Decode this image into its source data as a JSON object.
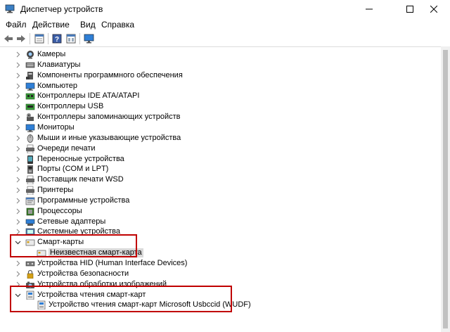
{
  "window": {
    "title": "Диспетчер устройств"
  },
  "menu": {
    "items": [
      {
        "label": "Файл"
      },
      {
        "label": "Действие"
      },
      {
        "label": "Вид"
      },
      {
        "label": "Справка"
      }
    ]
  },
  "toolbar": {
    "buttons": [
      {
        "icon": "back-arrow-icon"
      },
      {
        "icon": "forward-arrow-icon"
      },
      {
        "icon": "properties-icon"
      },
      {
        "icon": "help-icon"
      },
      {
        "icon": "details-icon"
      },
      {
        "icon": "monitor-icon"
      }
    ]
  },
  "tree": {
    "nodes": [
      {
        "label": "Камеры",
        "icon": "camera-icon",
        "expanded": false
      },
      {
        "label": "Клавиатуры",
        "icon": "keyboard-icon",
        "expanded": false
      },
      {
        "label": "Компоненты программного обеспечения",
        "icon": "software-component-icon",
        "expanded": false
      },
      {
        "label": "Компьютер",
        "icon": "computer-icon",
        "expanded": false
      },
      {
        "label": "Контроллеры IDE ATA/ATAPI",
        "icon": "ide-controller-icon",
        "expanded": false
      },
      {
        "label": "Контроллеры USB",
        "icon": "usb-icon",
        "expanded": false
      },
      {
        "label": "Контроллеры запоминающих устройств",
        "icon": "storage-controller-icon",
        "expanded": false
      },
      {
        "label": "Мониторы",
        "icon": "monitor-icon",
        "expanded": false
      },
      {
        "label": "Мыши и иные указывающие устройства",
        "icon": "mouse-icon",
        "expanded": false
      },
      {
        "label": "Очереди печати",
        "icon": "print-queue-icon",
        "expanded": false
      },
      {
        "label": "Переносные устройства",
        "icon": "portable-device-icon",
        "expanded": false
      },
      {
        "label": "Порты (COM и LPT)",
        "icon": "port-icon",
        "expanded": false
      },
      {
        "label": "Поставщик печати WSD",
        "icon": "printer-icon",
        "expanded": false
      },
      {
        "label": "Принтеры",
        "icon": "printer-icon",
        "expanded": false
      },
      {
        "label": "Программные устройства",
        "icon": "software-device-icon",
        "expanded": false
      },
      {
        "label": "Процессоры",
        "icon": "processor-icon",
        "expanded": false
      },
      {
        "label": "Сетевые адаптеры",
        "icon": "network-adapter-icon",
        "expanded": false
      },
      {
        "label": "Системные устройства",
        "icon": "system-device-icon",
        "expanded": false
      },
      {
        "label": "Смарт-карты",
        "icon": "smart-card-icon",
        "expanded": true
      },
      {
        "label": "Неизвестная смарт-карта",
        "icon": "smart-card-icon",
        "child": true,
        "selected": true
      },
      {
        "label": "Устройства HID (Human Interface Devices)",
        "icon": "hid-icon",
        "expanded": false
      },
      {
        "label": "Устройства безопасности",
        "icon": "security-device-icon",
        "expanded": false
      },
      {
        "label": "Устройства обработки изображений",
        "icon": "imaging-device-icon",
        "expanded": false
      },
      {
        "label": "Устройства чтения смарт-карт",
        "icon": "smart-card-reader-icon",
        "expanded": true
      },
      {
        "label": "Устройство чтения смарт-карт Microsoft Usbccid (WUDF)",
        "icon": "smart-card-reader-icon",
        "child": true
      }
    ]
  },
  "colors": {
    "highlight": "#c00000",
    "selection": "#d9d9d9"
  }
}
